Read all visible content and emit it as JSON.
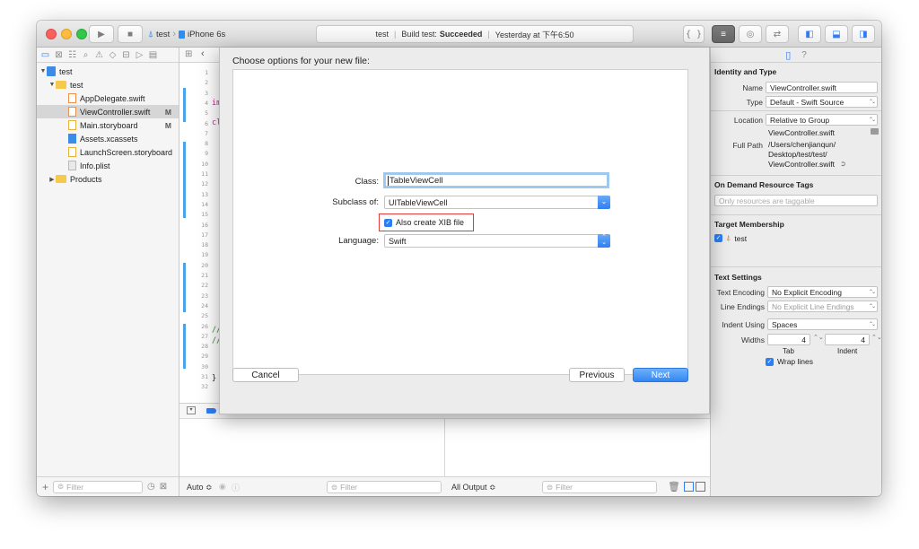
{
  "toolbar": {
    "run_icon": "play-icon",
    "stop_icon": "stop-icon",
    "scheme_name": "test",
    "device_name": "iPhone 6s",
    "activity_project": "test",
    "activity_status_prefix": "Build test:",
    "activity_status": "Succeeded",
    "activity_time": "Yesterday at 下午6:50",
    "standard_editor_label": "{ }"
  },
  "navigator": {
    "project": "test",
    "group": "test",
    "files": [
      {
        "name": "AppDelegate.swift",
        "badge": ""
      },
      {
        "name": "ViewController.swift",
        "badge": "M"
      },
      {
        "name": "Main.storyboard",
        "badge": "M"
      },
      {
        "name": "Assets.xcassets",
        "badge": ""
      },
      {
        "name": "LaunchScreen.storyboard",
        "badge": ""
      },
      {
        "name": "Info.plist",
        "badge": ""
      }
    ],
    "products": "Products",
    "filter_placeholder": "Filter"
  },
  "editor": {
    "line_numbers": [
      "1",
      "2",
      "3",
      "4",
      "5",
      "6",
      "7",
      "8",
      "9",
      "10",
      "11",
      "12",
      "13",
      "14",
      "15",
      "16",
      "17",
      "18",
      "19",
      "20",
      "21",
      "22",
      "23",
      "24",
      "25",
      "26",
      "27",
      "28",
      "29",
      "30",
      "31",
      "32"
    ],
    "code_import": "im",
    "code_class": "cl",
    "code_comment1": "//",
    "code_comment2": "//",
    "code_brace": "}",
    "bottom_auto": "Auto ≎",
    "bottom_filter1": "Filter",
    "bottom_output": "All Output ≎",
    "bottom_filter2": "Filter"
  },
  "inspector": {
    "identity_header": "Identity and Type",
    "name_label": "Name",
    "name_value": "ViewController.swift",
    "type_label": "Type",
    "type_value": "Default - Swift Source",
    "location_label": "Location",
    "location_value": "Relative to Group",
    "location_file": "ViewController.swift",
    "fullpath_label": "Full Path",
    "fullpath_line1": "/Users/chenjianqun/",
    "fullpath_line2": "Desktop/test/test/",
    "fullpath_line3": "ViewController.swift",
    "odr_header": "On Demand Resource Tags",
    "odr_placeholder": "Only resources are taggable",
    "target_header": "Target Membership",
    "target_name": "test",
    "text_settings_header": "Text Settings",
    "encoding_label": "Text Encoding",
    "encoding_value": "No Explicit Encoding",
    "line_endings_label": "Line Endings",
    "line_endings_value": "No Explicit Line Endings",
    "indent_using_label": "Indent Using",
    "indent_using_value": "Spaces",
    "widths_label": "Widths",
    "tab_width": "4",
    "indent_width": "4",
    "tab_caption": "Tab",
    "indent_caption": "Indent",
    "wrap_lines": "Wrap lines"
  },
  "dialog": {
    "title": "Choose options for your new file:",
    "class_label": "Class:",
    "class_value": "TableViewCell",
    "subclass_label": "Subclass of:",
    "subclass_value": "UITableViewCell",
    "xib_label": "Also create XIB file",
    "xib_checked": true,
    "language_label": "Language:",
    "language_value": "Swift",
    "cancel": "Cancel",
    "previous": "Previous",
    "next": "Next"
  }
}
